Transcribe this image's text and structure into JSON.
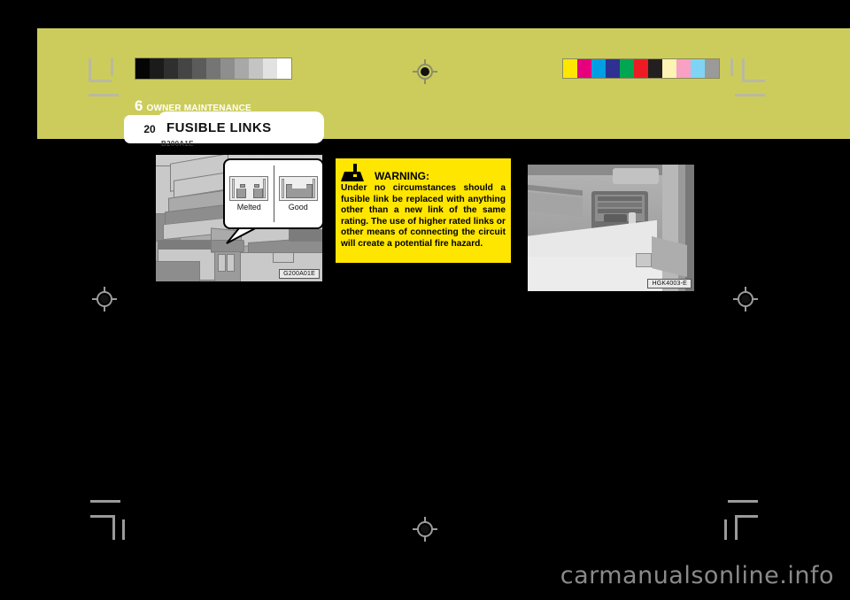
{
  "page": {
    "background_color": "#000000",
    "band_color": "#cccc5c",
    "watermark": "carmanualsonline.info"
  },
  "header": {
    "chapter_number": "6",
    "chapter_title": "OWNER MAINTENANCE",
    "page_number": "20",
    "section_title": "FUSIBLE  LINKS",
    "hidden_code": "B200A1E"
  },
  "calibration": {
    "gray_ramp_label": "grayscale-step-wedge",
    "gray_values": [
      "#050505",
      "#1b1b1b",
      "#2f2f2f",
      "#454545",
      "#5b5b5b",
      "#757575",
      "#8e8e8e",
      "#a8a8a8",
      "#c4c4c4",
      "#e2e2e2",
      "#ffffff"
    ],
    "color_ramp_label": "color-control-patches",
    "color_values": [
      "#ffe600",
      "#e6007e",
      "#009fe3",
      "#2e3192",
      "#00a651",
      "#ed1c24",
      "#231f20",
      "#fdf3b5",
      "#f9a0c5",
      "#7fd4f5",
      "#9a9a9a"
    ]
  },
  "figures": [
    {
      "name": "fusible-link-inspection-photo",
      "caption": "G200A01E",
      "callout": {
        "left_label": "Melted",
        "right_label": "Good"
      }
    },
    {
      "name": "fuse-panel-location-photo",
      "caption": "HGK4003-E"
    }
  ],
  "warning": {
    "icon": "warning-triangle-icon",
    "title": "WARNING:",
    "text": "Under no circumstances should a fusible link be replaced with anything other than a new link of the same rating. The use of higher rated links or other means of connecting the circuit will create a potential fire hazard.",
    "background_color": "#ffe600",
    "text_color": "#000000"
  }
}
